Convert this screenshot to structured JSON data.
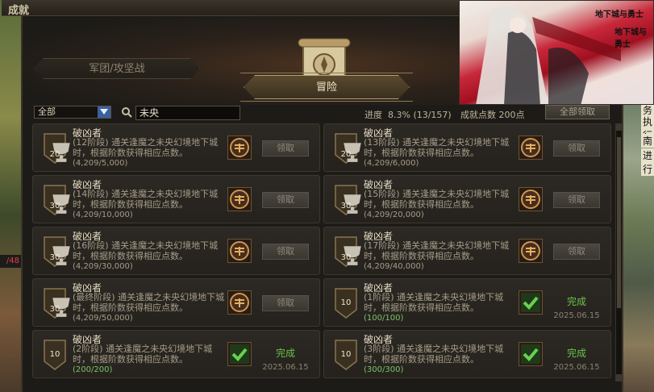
{
  "window": {
    "title": "成就"
  },
  "background": {
    "hp_text": "/48",
    "right_texts": [
      "务",
      "执行",
      "南",
      "进行"
    ]
  },
  "tabs": {
    "legion": "军团/攻坚战",
    "adventure": "冒险"
  },
  "filter": {
    "selected": "全部",
    "search_value": "未央"
  },
  "progress": {
    "label": "进度",
    "value": "8.3% (13/157)"
  },
  "points": {
    "text": "成就点数 200点"
  },
  "buttons": {
    "claim_all": "全部领取",
    "claim": "领取"
  },
  "promo": {
    "logo_top": "地下城与勇士",
    "logo_bottom": "地下城与勇士"
  },
  "cards": [
    {
      "title": "破凶者",
      "desc": "(12阶段) 通关逢魔之未央幻境地下城时，根据阶数获得相应点数。",
      "count": "(4,209/5,000)",
      "score": "20",
      "cup": true,
      "completed": false
    },
    {
      "title": "破凶者",
      "desc": "(13阶段) 通关逢魔之未央幻境地下城时，根据阶数获得相应点数。",
      "count": "(4,209/6,000)",
      "score": "20",
      "cup": true,
      "completed": false
    },
    {
      "title": "破凶者",
      "desc": "(14阶段) 通关逢魔之未央幻境地下城时，根据阶数获得相应点数。",
      "count": "(4,209/10,000)",
      "score": "30",
      "cup": true,
      "completed": false
    },
    {
      "title": "破凶者",
      "desc": "(15阶段) 通关逢魔之未央幻境地下城时，根据阶数获得相应点数。",
      "count": "(4,209/20,000)",
      "score": "30",
      "cup": true,
      "completed": false
    },
    {
      "title": "破凶者",
      "desc": "(16阶段) 通关逢魔之未央幻境地下城时，根据阶数获得相应点数。",
      "count": "(4,209/30,000)",
      "score": "30",
      "cup": true,
      "completed": false
    },
    {
      "title": "破凶者",
      "desc": "(17阶段) 通关逢魔之未央幻境地下城时，根据阶数获得相应点数。",
      "count": "(4,209/40,000)",
      "score": "30",
      "cup": true,
      "completed": false
    },
    {
      "title": "破凶者",
      "desc": "(最终阶段) 通关逢魔之未央幻境地下城时，根据阶数获得相应点数。",
      "count": "(4,209/50,000)",
      "score": "30",
      "cup": true,
      "completed": false
    },
    {
      "title": "破凶者",
      "desc": "(1阶段) 通关逢魔之未央幻境地下城时，根据阶数获得相应点数。",
      "count": "(100/100)",
      "score": "10",
      "cup": false,
      "completed": true,
      "status": "完成",
      "date": "2025.06.15"
    },
    {
      "title": "破凶者",
      "desc": "(2阶段) 通关逢魔之未央幻境地下城时，根据阶数获得相应点数。",
      "count": "(200/200)",
      "score": "10",
      "cup": false,
      "completed": true,
      "status": "完成",
      "date": "2025.06.15"
    },
    {
      "title": "破凶者",
      "desc": "(3阶段) 通关逢魔之未央幻境地下城时，根据阶数获得相应点数。",
      "count": "(300/300)",
      "score": "10",
      "cup": false,
      "completed": true,
      "status": "完成",
      "date": "2025.06.15"
    }
  ]
}
